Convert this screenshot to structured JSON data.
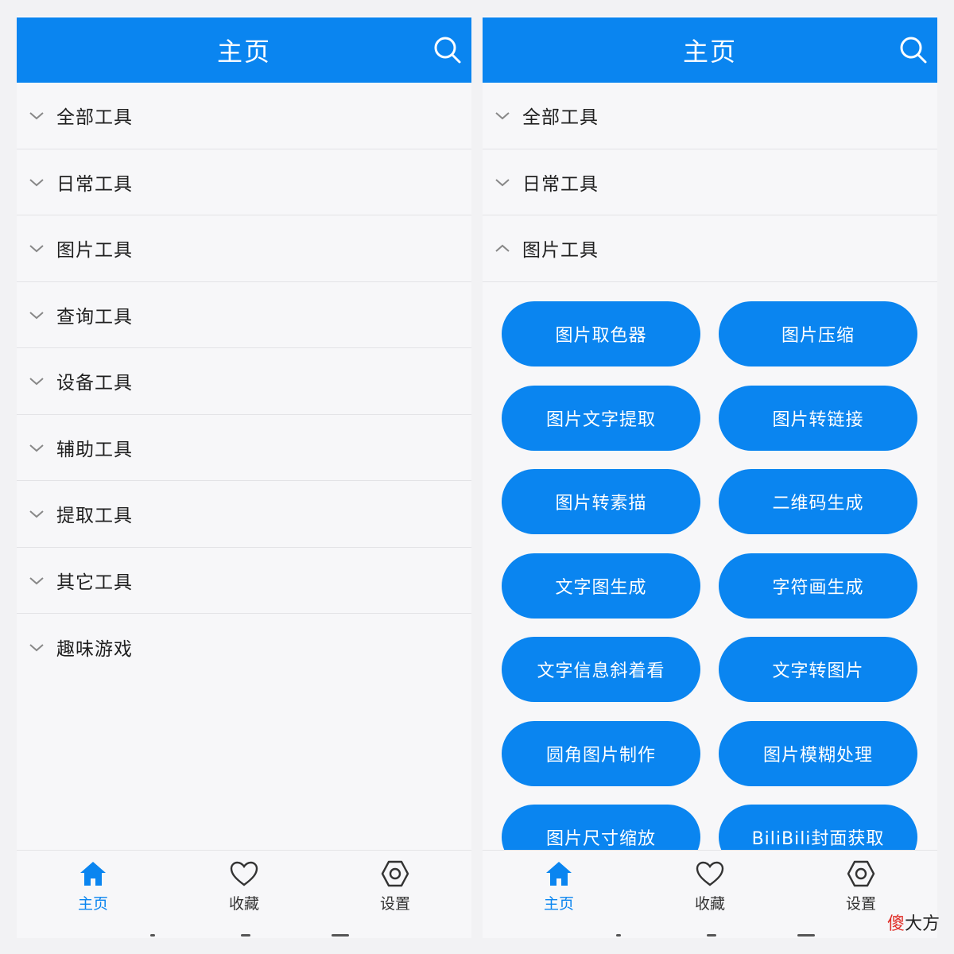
{
  "colors": {
    "primary": "#0a85f0",
    "background": "#f7f7f9",
    "text": "#1f1f1f"
  },
  "left_screen": {
    "appbar": {
      "title": "主页",
      "search_icon": "search-icon"
    },
    "categories": [
      {
        "label": "全部工具",
        "expanded": false
      },
      {
        "label": "日常工具",
        "expanded": false
      },
      {
        "label": "图片工具",
        "expanded": false
      },
      {
        "label": "查询工具",
        "expanded": false
      },
      {
        "label": "设备工具",
        "expanded": false
      },
      {
        "label": "辅助工具",
        "expanded": false
      },
      {
        "label": "提取工具",
        "expanded": false
      },
      {
        "label": "其它工具",
        "expanded": false
      },
      {
        "label": "趣味游戏",
        "expanded": false
      }
    ],
    "tabs": [
      {
        "label": "主页",
        "icon": "home-icon",
        "active": true
      },
      {
        "label": "收藏",
        "icon": "heart-icon",
        "active": false
      },
      {
        "label": "设置",
        "icon": "settings-icon",
        "active": false
      }
    ]
  },
  "right_screen": {
    "appbar": {
      "title": "主页",
      "search_icon": "search-icon"
    },
    "categories": [
      {
        "label": "全部工具",
        "expanded": false
      },
      {
        "label": "日常工具",
        "expanded": false
      },
      {
        "label": "图片工具",
        "expanded": true
      }
    ],
    "tools": [
      "图片取色器",
      "图片压缩",
      "图片文字提取",
      "图片转链接",
      "图片转素描",
      "二维码生成",
      "文字图生成",
      "字符画生成",
      "文字信息斜着看",
      "文字转图片",
      "圆角图片制作",
      "图片模糊处理",
      "图片尺寸缩放",
      "BiliBili封面获取"
    ],
    "tabs": [
      {
        "label": "主页",
        "icon": "home-icon",
        "active": true
      },
      {
        "label": "收藏",
        "icon": "heart-icon",
        "active": false
      },
      {
        "label": "设置",
        "icon": "settings-icon",
        "active": false
      }
    ]
  },
  "watermark": {
    "part1": "傻",
    "part2": "大方"
  }
}
